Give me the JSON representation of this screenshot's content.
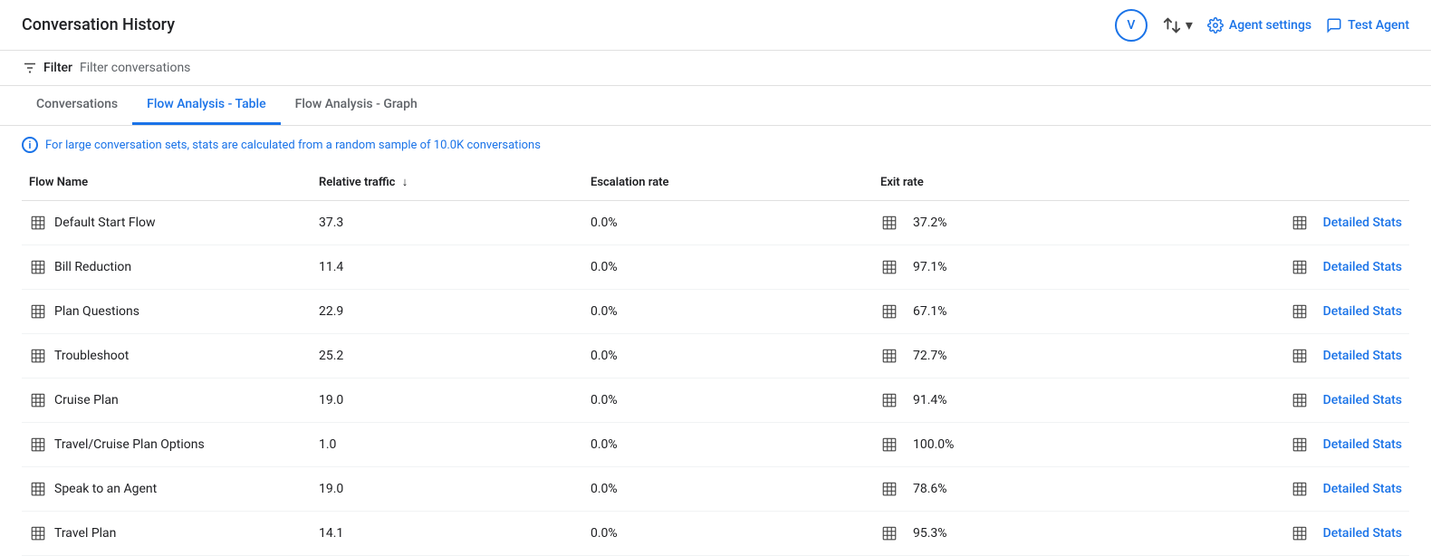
{
  "header": {
    "title": "Conversation History",
    "avatar_label": "V",
    "sort_icon_label": "sort-icon",
    "agent_settings_label": "Agent settings",
    "test_agent_label": "Test Agent"
  },
  "filter_bar": {
    "filter_label": "Filter",
    "filter_placeholder": "Filter conversations"
  },
  "tabs": [
    {
      "id": "conversations",
      "label": "Conversations",
      "active": false
    },
    {
      "id": "flow-analysis-table",
      "label": "Flow Analysis - Table",
      "active": true
    },
    {
      "id": "flow-analysis-graph",
      "label": "Flow Analysis - Graph",
      "active": false
    }
  ],
  "info_notice": "For large conversation sets, stats are calculated from a random sample of 10.0K conversations",
  "table": {
    "columns": [
      {
        "id": "flow_name",
        "label": "Flow Name",
        "sortable": false
      },
      {
        "id": "relative_traffic",
        "label": "Relative traffic",
        "sortable": true,
        "sort_direction": "desc"
      },
      {
        "id": "escalation_rate",
        "label": "Escalation rate",
        "sortable": false
      },
      {
        "id": "exit_rate",
        "label": "Exit rate",
        "sortable": false
      },
      {
        "id": "actions",
        "label": "",
        "sortable": false
      }
    ],
    "rows": [
      {
        "flow_name": "Default Start Flow",
        "relative_traffic": "37.3",
        "escalation_rate": "0.0%",
        "exit_rate": "37.2%",
        "action_label": "Detailed Stats"
      },
      {
        "flow_name": "Bill Reduction",
        "relative_traffic": "11.4",
        "escalation_rate": "0.0%",
        "exit_rate": "97.1%",
        "action_label": "Detailed Stats"
      },
      {
        "flow_name": "Plan Questions",
        "relative_traffic": "22.9",
        "escalation_rate": "0.0%",
        "exit_rate": "67.1%",
        "action_label": "Detailed Stats"
      },
      {
        "flow_name": "Troubleshoot",
        "relative_traffic": "25.2",
        "escalation_rate": "0.0%",
        "exit_rate": "72.7%",
        "action_label": "Detailed Stats"
      },
      {
        "flow_name": "Cruise Plan",
        "relative_traffic": "19.0",
        "escalation_rate": "0.0%",
        "exit_rate": "91.4%",
        "action_label": "Detailed Stats"
      },
      {
        "flow_name": "Travel/Cruise Plan Options",
        "relative_traffic": "1.0",
        "escalation_rate": "0.0%",
        "exit_rate": "100.0%",
        "action_label": "Detailed Stats"
      },
      {
        "flow_name": "Speak to an Agent",
        "relative_traffic": "19.0",
        "escalation_rate": "0.0%",
        "exit_rate": "78.6%",
        "action_label": "Detailed Stats"
      },
      {
        "flow_name": "Travel Plan",
        "relative_traffic": "14.1",
        "escalation_rate": "0.0%",
        "exit_rate": "95.3%",
        "action_label": "Detailed Stats"
      }
    ]
  },
  "icons": {
    "filter": "☰",
    "table_icon": "▦",
    "sort_down": "↓",
    "info": "i",
    "chevron_down": "▾"
  }
}
